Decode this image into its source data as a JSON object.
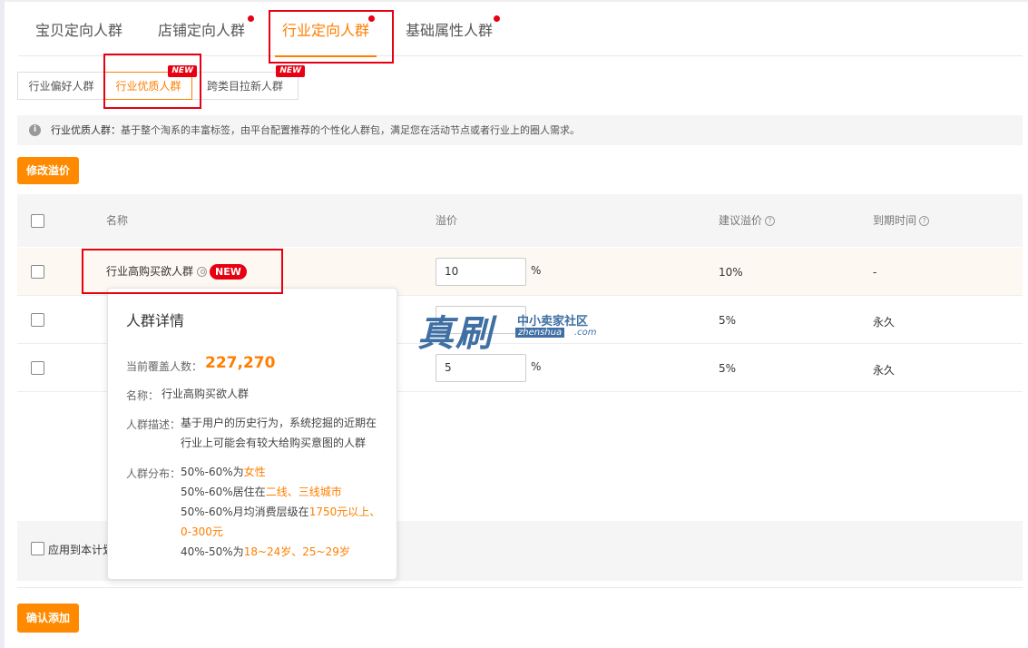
{
  "main_tabs": [
    {
      "label": "宝贝定向人群",
      "active": false,
      "dot": false
    },
    {
      "label": "店铺定向人群",
      "active": false,
      "dot": true
    },
    {
      "label": "行业定向人群",
      "active": true,
      "dot": true
    },
    {
      "label": "基础属性人群",
      "active": false,
      "dot": true
    }
  ],
  "sub_tabs": [
    {
      "label": "行业偏好人群",
      "active": false,
      "new": false
    },
    {
      "label": "行业优质人群",
      "active": true,
      "new": true
    },
    {
      "label": "跨类目拉新人群",
      "active": false,
      "new": true
    }
  ],
  "new_tag": "NEW",
  "info": {
    "icon": "info-icon",
    "title": "行业优质人群：",
    "text": "基于整个淘系的丰富标签，由平台配置推荐的个性化人群包，满足您在活动节点或者行业上的圈人需求。"
  },
  "modify_premium_button": "修改溢价",
  "table": {
    "headers": {
      "name": "名称",
      "premium": "溢价",
      "suggested": "建议溢价",
      "expiry": "到期时间"
    },
    "rows": [
      {
        "name": "行业高购买欲人群",
        "premium": "10",
        "unit": "%",
        "suggested": "10%",
        "expiry": "-",
        "new": true
      },
      {
        "name": "",
        "premium": "",
        "unit": "",
        "suggested": "5%",
        "expiry": "永久",
        "new": false
      },
      {
        "name": "",
        "premium": "5",
        "unit": "%",
        "suggested": "5%",
        "expiry": "永久",
        "new": false
      }
    ]
  },
  "apply_to_plan_label": "应用到本计划",
  "confirm_button": "确认添加",
  "popover": {
    "title": "人群详情",
    "coverage_label": "当前覆盖人数：",
    "coverage_value": "227,270",
    "name_label": "名称：",
    "name_value": "行业高购买欲人群",
    "desc_label": "人群描述：",
    "desc_line1": "基于用户的历史行为，系统挖掘的近期在",
    "desc_line2": "行业上可能会有较大给购买意图的人群",
    "dist_label": "人群分布：",
    "dist": [
      {
        "pre": "50%-60%为",
        "hl": "女性"
      },
      {
        "pre": "50%-60%居住在",
        "hl": "二线、三线城市"
      },
      {
        "pre": "50%-60%月均消费层级在",
        "hl": "1750元以上、"
      },
      {
        "pre": "",
        "hl": "0-300元"
      },
      {
        "pre": "40%-50%为",
        "hl": "18~24岁、25~29岁"
      }
    ]
  },
  "watermark": {
    "big": "真刷",
    "small": "中小卖家社区",
    "url": "zhenshua",
    "com": ".com"
  }
}
